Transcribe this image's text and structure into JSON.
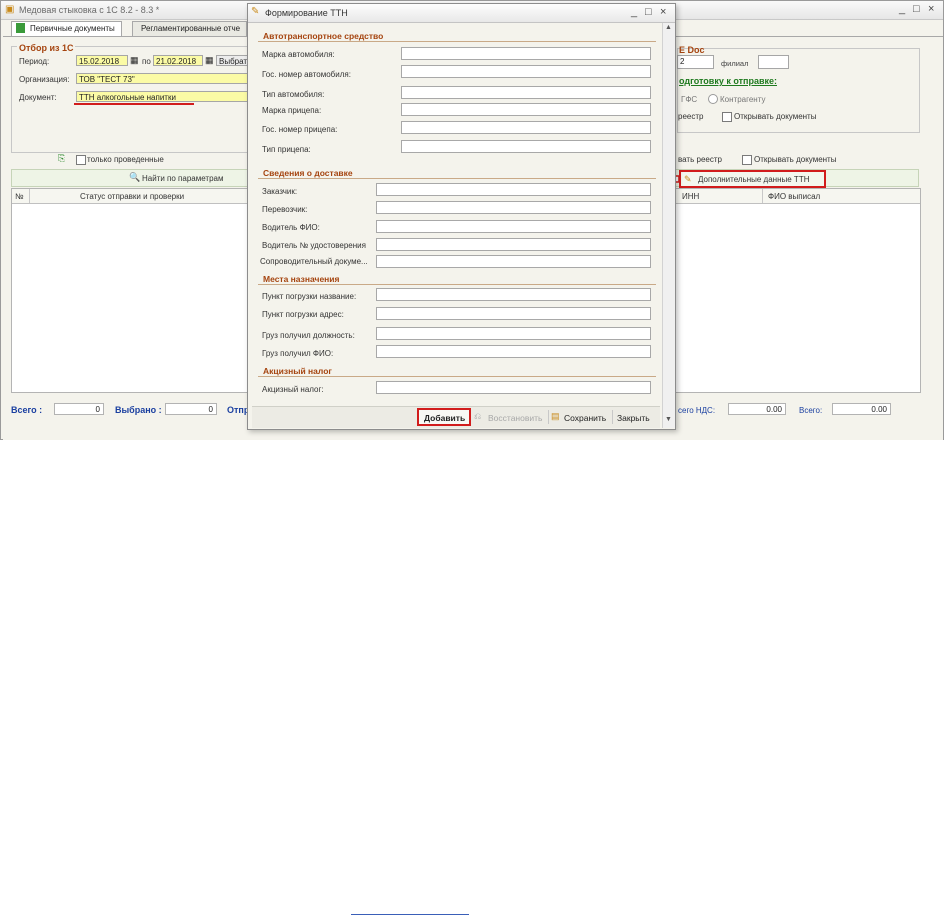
{
  "main_window": {
    "title": "Медовая стыковка с 1С 8.2 - 8.3 *",
    "controls": {
      "minimize": "_",
      "maximize": "□",
      "close": "×"
    },
    "tabs": [
      "Первичные документы",
      "Регламентированные отче"
    ]
  },
  "filter": {
    "group_title": "Отбор из 1С",
    "period_label": "Период:",
    "period_from": "15.02.2018",
    "period_to_label": "по",
    "period_to": "21.02.2018",
    "select_button": "Выбрат",
    "org_label": "Организация:",
    "org_value": "ТОВ \"ТЕСТ 73\"",
    "doc_label": "Документ:",
    "doc_value": "ТТН алкогольные напитки",
    "only_posted": "только проведенные"
  },
  "right_panel": {
    "doc_title": "E Doc",
    "number_value": "2",
    "branch_label": "филиал",
    "prepare_title": "одготовку к отправке:",
    "radio_gfs": "ГФС",
    "radio_contractor": "Контрагенту",
    "registry_label": "реестр",
    "open_docs_1": "Открывать документы",
    "make_registry": "вать реестр",
    "open_docs_2": "Открывать документы"
  },
  "toolbar": {
    "find_button": "Найти по параметрам",
    "extra_ttn_button": "Дополнительные данные ТТН"
  },
  "grid": {
    "left_columns": [
      "№",
      "Статус отправки и проверки"
    ],
    "right_columns": [
      "ИНН",
      "ФИО выписал"
    ]
  },
  "totals": {
    "total_label": "Всего :",
    "total_value": "0",
    "selected_label": "Выбрано :",
    "selected_value": "0",
    "sent_label": "Отпр",
    "vat_label": "сего НДС:",
    "vat_value": "0.00",
    "sum_label": "Всего:",
    "sum_value": "0.00"
  },
  "dialog": {
    "title": "Формирование ТТН",
    "sections": {
      "vehicle": {
        "title": "Автотранспортное средство",
        "fields": [
          "Марка автомобиля:",
          "Гос. номер автомобиля:",
          "Тип автомобиля:",
          "Марка прицепа:",
          "Гос. номер прицепа:",
          "Тип прицепа:"
        ]
      },
      "delivery": {
        "title": "Сведения о доставке",
        "fields": [
          "Заказчик:",
          "Перевозчик:",
          "Водитель ФИО:",
          "Водитель № удостоверения",
          "Сопроводительный докуме..."
        ]
      },
      "destination": {
        "title": "Места назначения",
        "fields": [
          "Пункт погрузки название:",
          "Пункт погрузки адрес:",
          "Груз получил должность:",
          "Груз получил ФИО:"
        ]
      },
      "excise": {
        "title": "Акцизный налог",
        "fields": [
          "Акцизный налог:"
        ]
      }
    },
    "buttons": {
      "add": "Добавить",
      "restore": "Восстановить",
      "save": "Сохранить",
      "close": "Закрыть"
    }
  },
  "colors": {
    "highlight_red": "#d11c1c",
    "section_brown": "#a5440f",
    "totals_blue": "#1a3fa0",
    "required_yellow": "#fbfba5"
  }
}
